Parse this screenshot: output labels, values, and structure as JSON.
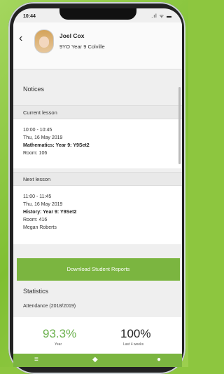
{
  "status": {
    "time": "10:44",
    "signal": ".ıl ᯤ ▬"
  },
  "header": {
    "student_name": "Joel Cox",
    "student_info": "9YO  Year 9  Colville"
  },
  "notices": {
    "title": "Notices"
  },
  "current_lesson": {
    "heading": "Current lesson",
    "time": "10:00 - 10:45",
    "date": "Thu, 16 May 2019",
    "subject": "Mathematics: Year 9: Y9Set2",
    "room": "Room: 106"
  },
  "next_lesson": {
    "heading": "Next lesson",
    "time": "11:00 - 11:45",
    "date": "Thu, 16 May 2019",
    "subject": "History: Year 9: Y9Set2",
    "room": "Room: 416",
    "teacher": "Megan Roberts"
  },
  "download_button": {
    "label": "Download Student Reports"
  },
  "statistics": {
    "title": "Statistics",
    "attendance_label": "Attendance (2018/2019)",
    "year_value": "93.3%",
    "year_caption": "Year",
    "weeks_value": "100%",
    "weeks_caption": "Last 4 weeks"
  },
  "colors": {
    "accent": "#7bb540",
    "percent_green": "#6ab04c"
  }
}
